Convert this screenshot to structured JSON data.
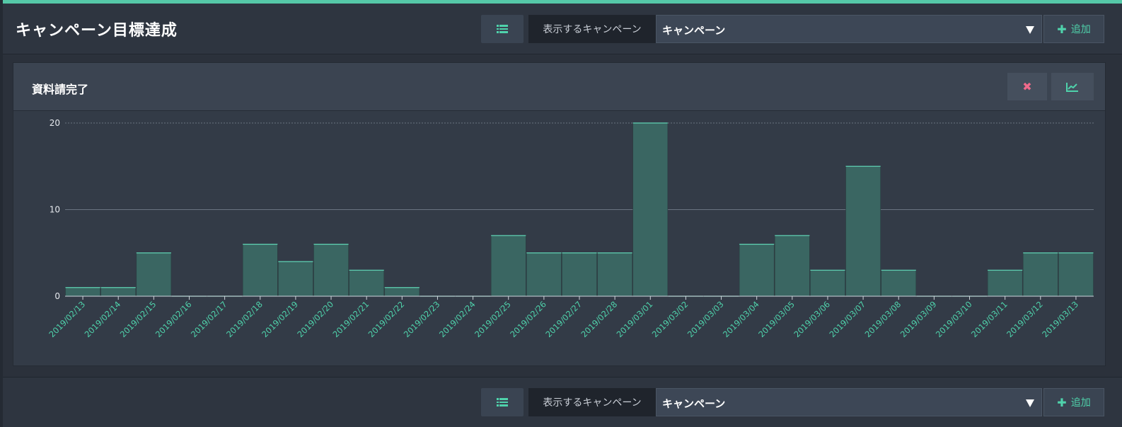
{
  "page": {
    "title": "キャンペーン目標達成"
  },
  "toolbar": {
    "select_label": "表示するキャンペーン",
    "select_value": "キャンペーン",
    "add_label": "追加"
  },
  "toolbar2": {
    "select_label": "表示するキャンペーン",
    "select_value": "キャンペーン",
    "add_label": "追加"
  },
  "panel": {
    "title": "資料請完了"
  },
  "colors": {
    "accent": "#4fd2ab",
    "bar_fill": "#3a6662",
    "bar_top": "#5fd3b4",
    "close_icon": "#f06a8b"
  },
  "icons": {
    "list": "list-icon",
    "close": "close-icon",
    "chart": "line-chart-icon",
    "add": "plus-icon",
    "dropdown": "caret-down-icon"
  },
  "chart_data": {
    "type": "bar",
    "categories": [
      "2019/02/13",
      "2019/02/14",
      "2019/02/15",
      "2019/02/16",
      "2019/02/17",
      "2019/02/18",
      "2019/02/19",
      "2019/02/20",
      "2019/02/21",
      "2019/02/22",
      "2019/02/23",
      "2019/02/24",
      "2019/02/25",
      "2019/02/26",
      "2019/02/27",
      "2019/02/28",
      "2019/03/01",
      "2019/03/02",
      "2019/03/03",
      "2019/03/04",
      "2019/03/05",
      "2019/03/06",
      "2019/03/07",
      "2019/03/08",
      "2019/03/09",
      "2019/03/10",
      "2019/03/11",
      "2019/03/12",
      "2019/03/13"
    ],
    "values": [
      1,
      1,
      5,
      0,
      0,
      6,
      4,
      6,
      3,
      1,
      0,
      0,
      7,
      5,
      5,
      5,
      20,
      0,
      0,
      6,
      7,
      3,
      15,
      3,
      0,
      0,
      3,
      5,
      5
    ],
    "yticks": [
      0,
      10,
      20
    ],
    "ylim": [
      0,
      20
    ],
    "grid": true
  }
}
